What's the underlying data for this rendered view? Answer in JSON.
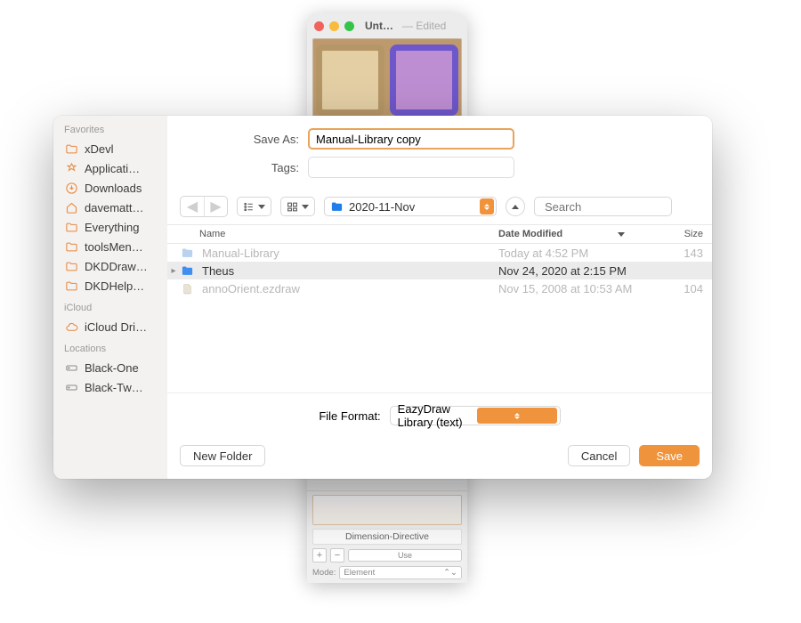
{
  "bg_window": {
    "title": "Unt…",
    "edited": "— Edited",
    "bottom_label": "Dimension-Directive",
    "use_label": "Use",
    "mode_label": "Mode:",
    "mode_value": "Element"
  },
  "labels": {
    "save_as": "Save As:",
    "tags": "Tags:",
    "file_format": "File Format:"
  },
  "save_as_value": "Manual-Library copy",
  "folder_name": "2020-11-Nov",
  "search_placeholder": "Search",
  "file_format_value": "EazyDraw Library (text)",
  "columns": {
    "name": "Name",
    "date": "Date Modified",
    "size": "Size"
  },
  "sidebar": {
    "groups": [
      {
        "title": "Favorites",
        "items": [
          {
            "icon": "folder",
            "label": "xDevl"
          },
          {
            "icon": "apps",
            "label": "Applicati…"
          },
          {
            "icon": "download",
            "label": "Downloads"
          },
          {
            "icon": "home",
            "label": "davematt…"
          },
          {
            "icon": "folder",
            "label": "Everything"
          },
          {
            "icon": "folder",
            "label": "toolsMen…"
          },
          {
            "icon": "folder",
            "label": "DKDDraw…"
          },
          {
            "icon": "folder",
            "label": "DKDHelp…"
          }
        ]
      },
      {
        "title": "iCloud",
        "items": [
          {
            "icon": "cloud",
            "label": "iCloud Dri…"
          }
        ]
      },
      {
        "title": "Locations",
        "items": [
          {
            "icon": "disk",
            "label": "Black-One"
          },
          {
            "icon": "disk",
            "label": "Black-Tw…"
          }
        ]
      }
    ]
  },
  "rows": [
    {
      "kind": "folder",
      "dim": true,
      "sel": false,
      "name": "Manual-Library",
      "date": "Today at 4:52 PM",
      "size": "143"
    },
    {
      "kind": "folder",
      "dim": false,
      "sel": true,
      "name": "Theus",
      "date": "Nov 24, 2020 at 2:15 PM",
      "size": ""
    },
    {
      "kind": "file",
      "dim": true,
      "sel": false,
      "name": "annoOrient.ezdraw",
      "date": "Nov 15, 2008 at 10:53 AM",
      "size": "104"
    }
  ],
  "buttons": {
    "new_folder": "New Folder",
    "cancel": "Cancel",
    "save": "Save"
  }
}
